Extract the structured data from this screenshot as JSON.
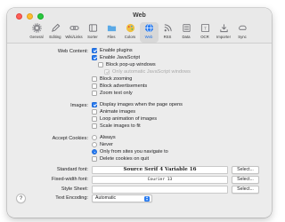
{
  "window": {
    "title": "Web"
  },
  "toolbar": {
    "tabs": [
      {
        "label": "General",
        "icon": "gear-icon"
      },
      {
        "label": "Editing",
        "icon": "pencil-icon"
      },
      {
        "label": "Wiki/Links",
        "icon": "link-icon"
      },
      {
        "label": "Sorter",
        "icon": "sorter-icon"
      },
      {
        "label": "Files",
        "icon": "folder-icon"
      },
      {
        "label": "Colors",
        "icon": "palette-icon"
      },
      {
        "label": "Web",
        "icon": "globe-icon",
        "active": true
      },
      {
        "label": "RSS",
        "icon": "rss-icon"
      },
      {
        "label": "Data",
        "icon": "data-icon"
      },
      {
        "label": "OCR",
        "icon": "ocr-icon"
      },
      {
        "label": "Importer",
        "icon": "importer-icon"
      },
      {
        "label": "Sync",
        "icon": "sync-icon"
      }
    ]
  },
  "web_content": {
    "label": "Web Content:",
    "enable_plugins": {
      "label": "Enable plugins",
      "checked": true
    },
    "enable_javascript": {
      "label": "Enable JavaScript",
      "checked": true
    },
    "block_popups": {
      "label": "Block pop-up windows",
      "checked": false
    },
    "only_automatic_js": {
      "label": "Only automatic JavaScript windows",
      "checked": true,
      "disabled": true
    },
    "block_zooming": {
      "label": "Block zooming",
      "checked": false
    },
    "block_ads": {
      "label": "Block advertisements",
      "checked": false
    },
    "zoom_text_only": {
      "label": "Zoom text only",
      "checked": false
    }
  },
  "images": {
    "label": "Images:",
    "display_images": {
      "label": "Display images when the page opens",
      "checked": true
    },
    "animate_images": {
      "label": "Animate images",
      "checked": false
    },
    "loop_animation": {
      "label": "Loop animation of images",
      "checked": false
    },
    "scale_images": {
      "label": "Scale images to fit",
      "checked": false
    }
  },
  "cookies": {
    "label": "Accept Cookies:",
    "options": [
      "Always",
      "Never",
      "Only from sites you navigate to"
    ],
    "selected": "Only from sites you navigate to",
    "delete_on_quit": {
      "label": "Delete cookies on quit",
      "checked": false
    }
  },
  "fonts": {
    "standard_label": "Standard font:",
    "standard_value": "Source Serif 4 Variable 16",
    "fixed_label": "Fixed-width font:",
    "fixed_value": "Courier 13",
    "stylesheet_label": "Style Sheet:",
    "stylesheet_value": "",
    "select_label": "Select..."
  },
  "encoding": {
    "label": "Text Encoding:",
    "value": "Automatic"
  },
  "help": {
    "label": "?"
  },
  "colors": {
    "accent": "#2a7cf0",
    "window_bg": "#ececec"
  }
}
